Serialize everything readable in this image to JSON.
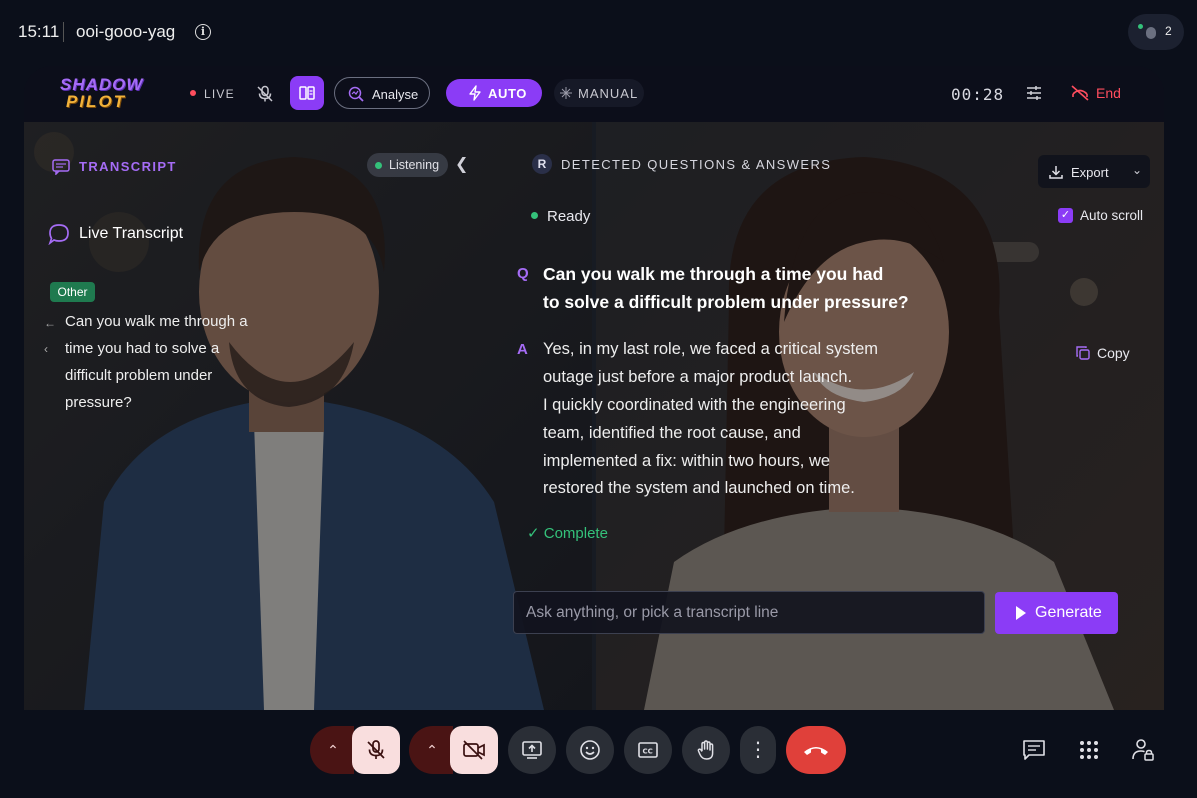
{
  "meet": {
    "time": "15:11",
    "meeting_code": "ooi-gooo-yag",
    "participant_count": "2"
  },
  "pilot": {
    "logo_line1": "SHADOW",
    "logo_line2": "PILOT",
    "live_label": "LIVE",
    "analyse_label": "Analyse",
    "auto_label": "AUTO",
    "manual_label": "MANUAL",
    "timer": "00:28",
    "end_label": "End",
    "accent": "#8b3cf6",
    "live_color": "#ff4d5e"
  },
  "transcript": {
    "header": "TRANSCRIPT",
    "status": "Listening",
    "title": "Live Transcript",
    "speaker_badge": "Other",
    "lines": [
      "Can you walk me through a",
      "time you had to solve a",
      "difficult problem under",
      "pressure?"
    ]
  },
  "qa": {
    "badge": "R",
    "header": "DETECTED QUESTIONS & ANSWERS",
    "export_label": "Export",
    "status": "Ready",
    "auto_scroll_label": "Auto scroll",
    "auto_scroll_checked": true,
    "q_marker": "Q",
    "question_lines": [
      "Can you walk me through a time you had",
      "to solve a difficult problem under pressure?"
    ],
    "a_marker": "A",
    "answer_lines": [
      "Yes, in my last role, we faced a critical system",
      "outage just before a major product launch.",
      "I quickly coordinated with the engineering",
      "team, identified the root cause, and",
      "implemented a fix: within two hours, we",
      "restored the system and launched on time."
    ],
    "copy_label": "Copy",
    "complete_label": "Complete",
    "ask_placeholder": "Ask anything, or pick a transcript line",
    "generate_label": "Generate"
  },
  "controls": {
    "mic_state": "muted",
    "camera_state": "off",
    "leave_color": "#e0403a"
  }
}
